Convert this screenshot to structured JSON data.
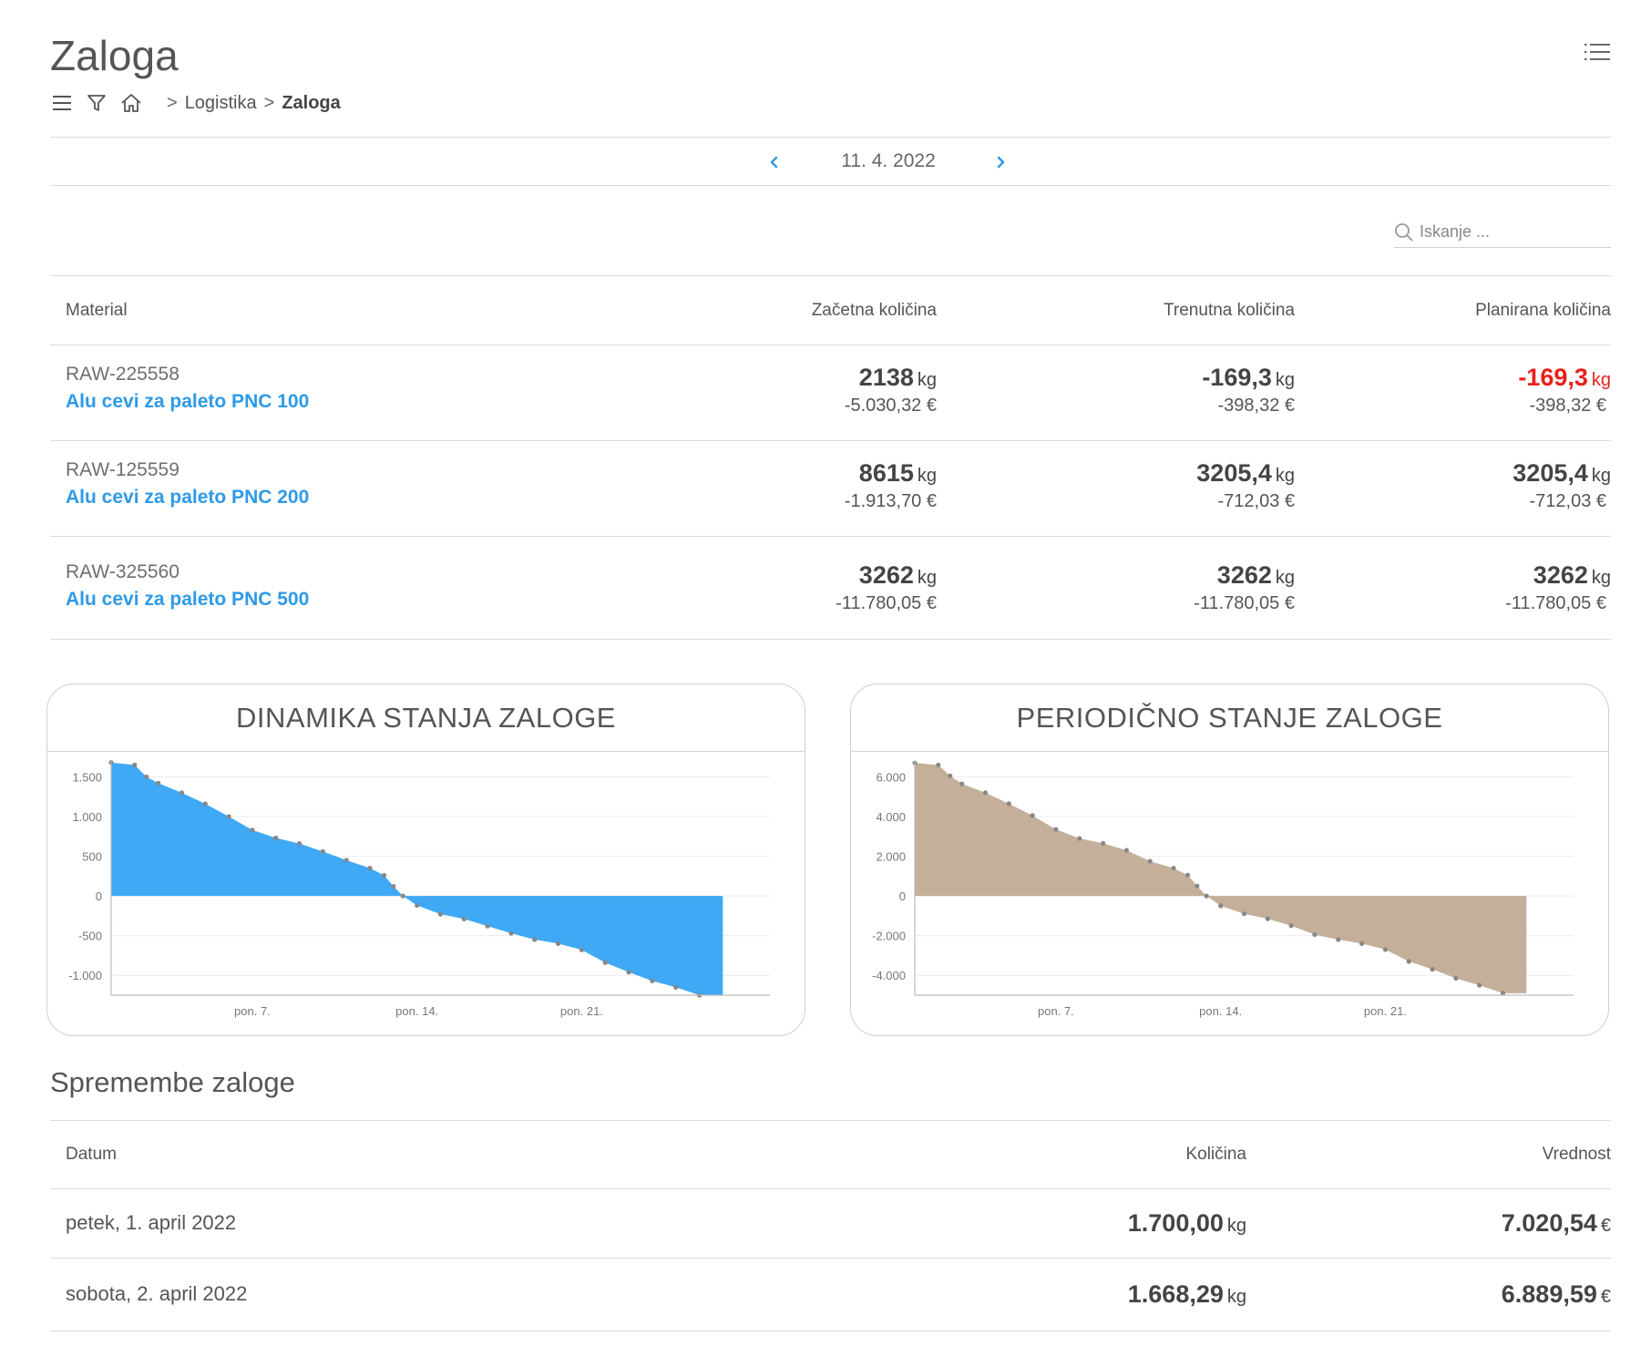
{
  "page": {
    "title": "Zaloga"
  },
  "breadcrumb": {
    "sep1": ">",
    "logistics": "Logistika",
    "sep2": ">",
    "current": "Zaloga"
  },
  "icons": {
    "toc": "list-icon",
    "menu": "hamburger-icon",
    "filter": "filter-icon",
    "home": "home-icon",
    "prev": "chevron-left-icon",
    "next": "chevron-right-icon",
    "search": "search-icon"
  },
  "date_nav": {
    "date": "11. 4. 2022"
  },
  "search": {
    "placeholder": "Iskanje ..."
  },
  "stock_table": {
    "headers": {
      "material": "Material",
      "initial": "Začetna količina",
      "current": "Trenutna količina",
      "planned": "Planirana količina"
    },
    "unit": "kg",
    "rows": [
      {
        "code": "RAW-225558",
        "name": "Alu cevi za paleto PNC 100",
        "initial_qty": "2138",
        "initial_val": "-5.030,32 €",
        "current_qty": "-169,3",
        "current_val": "-398,32 €",
        "planned_qty": "-169,3",
        "planned_val": "-398,32 €",
        "planned_negative": true
      },
      {
        "code": "RAW-125559",
        "name": "Alu cevi za paleto PNC 200",
        "initial_qty": "8615",
        "initial_val": "-1.913,70 €",
        "current_qty": "3205,4",
        "current_val": "-712,03 €",
        "planned_qty": "3205,4",
        "planned_val": "-712,03 €",
        "planned_negative": false
      },
      {
        "code": "RAW-325560",
        "name": "Alu cevi za paleto PNC 500",
        "initial_qty": "3262",
        "initial_val": "-11.780,05 €",
        "current_qty": "3262",
        "current_val": "-11.780,05 €",
        "planned_qty": "3262",
        "planned_val": "-11.780,05 €",
        "planned_negative": false
      }
    ]
  },
  "chart_data": [
    {
      "type": "area",
      "title": "DINAMIKA STANJA ZALOGE",
      "color": "#3fa9f5",
      "ylim": [
        -1250,
        1700
      ],
      "yticks": [
        1500,
        1000,
        500,
        0,
        -500,
        -1000
      ],
      "ytick_labels": [
        "1.500",
        "1.000",
        "500",
        "0",
        "-500",
        "-1.000"
      ],
      "xlim": [
        1,
        29
      ],
      "xticks": [
        7,
        14,
        21
      ],
      "xtick_labels": [
        "pon. 7.",
        "pon. 14.",
        "pon. 21."
      ],
      "grid": true,
      "x": [
        1,
        2,
        2.5,
        3,
        4,
        5,
        6,
        7,
        8,
        9,
        10,
        11,
        12,
        12.6,
        13,
        13.4,
        14,
        15,
        16,
        17,
        18,
        19,
        20,
        21,
        22,
        23,
        24,
        25,
        26,
        26.4,
        27
      ],
      "values": [
        1680,
        1650,
        1500,
        1420,
        1300,
        1160,
        1000,
        830,
        730,
        660,
        560,
        450,
        350,
        260,
        120,
        0,
        -120,
        -230,
        -290,
        -380,
        -470,
        -550,
        -600,
        -680,
        -840,
        -960,
        -1070,
        -1150,
        -1250,
        -1250,
        -1250
      ]
    },
    {
      "type": "area",
      "title": "PERIODIČNO STANJE ZALOGE",
      "color": "#c4b09a",
      "ylim": [
        -5000,
        6800
      ],
      "yticks": [
        6000,
        4000,
        2000,
        0,
        -2000,
        -4000
      ],
      "ytick_labels": [
        "6.000",
        "4.000",
        "2.000",
        "0",
        "-2.000",
        "-4.000"
      ],
      "xlim": [
        1,
        29
      ],
      "xticks": [
        7,
        14,
        21
      ],
      "xtick_labels": [
        "pon. 7.",
        "pon. 14.",
        "pon. 21."
      ],
      "grid": true,
      "x": [
        1,
        2,
        2.5,
        3,
        4,
        5,
        6,
        7,
        8,
        9,
        10,
        11,
        12,
        12.6,
        13,
        13.4,
        14,
        15,
        16,
        17,
        18,
        19,
        20,
        21,
        22,
        23,
        24,
        25,
        26,
        26.4,
        27
      ],
      "values": [
        6700,
        6600,
        6050,
        5650,
        5200,
        4650,
        4050,
        3350,
        2900,
        2650,
        2300,
        1750,
        1400,
        1050,
        500,
        0,
        -500,
        -900,
        -1150,
        -1500,
        -1950,
        -2200,
        -2400,
        -2700,
        -3300,
        -3700,
        -4150,
        -4500,
        -4900,
        -4900,
        -4900
      ]
    }
  ],
  "changes": {
    "title": "Spremembe zaloge",
    "headers": {
      "date": "Datum",
      "qty": "Količina",
      "value": "Vrednost"
    },
    "qty_unit": "kg",
    "value_unit": "€",
    "rows": [
      {
        "date": "petek, 1. april 2022",
        "qty": "1.700,00",
        "value": "7.020,54"
      },
      {
        "date": "sobota, 2. april 2022",
        "qty": "1.668,29",
        "value": "6.889,59"
      }
    ]
  }
}
